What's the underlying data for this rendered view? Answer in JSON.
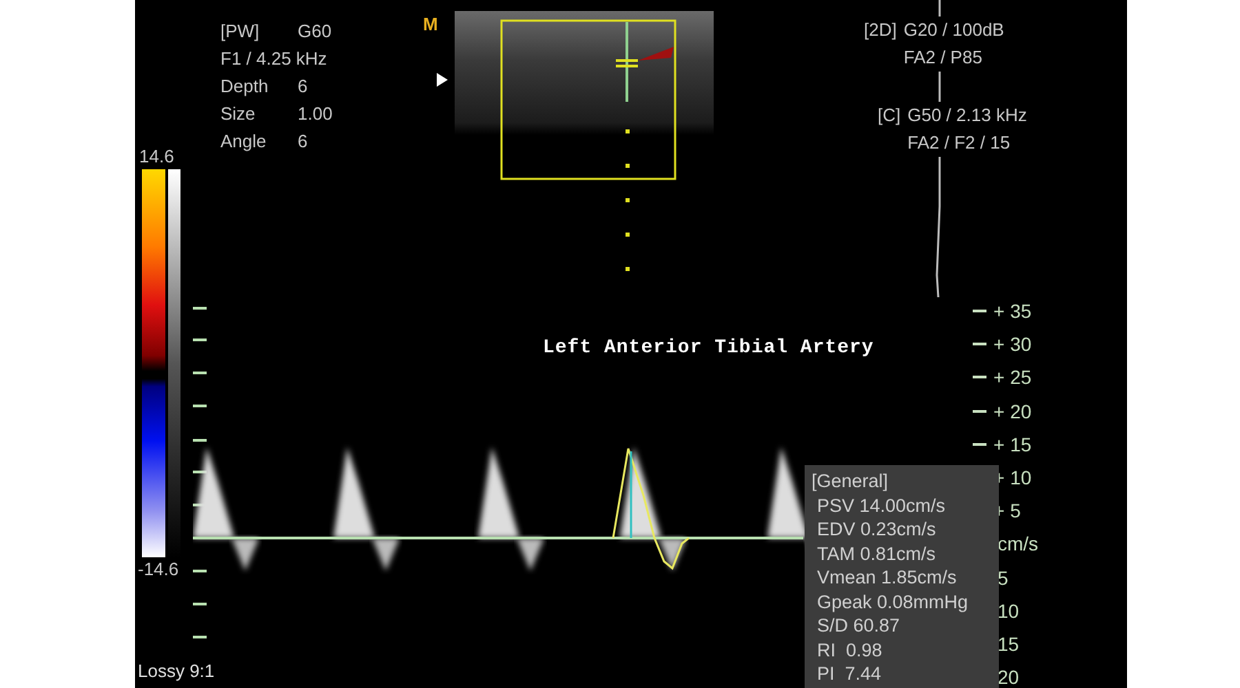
{
  "pw_params": [
    {
      "label": "[PW]",
      "value": "G60"
    },
    {
      "label": "F1 / 4.25 kHz"
    },
    {
      "label": "Depth",
      "value": "6"
    },
    {
      "label": "Size",
      "value": "1.00"
    },
    {
      "label": "Angle",
      "value": "6"
    }
  ],
  "mode_marker": "M",
  "image_params": [
    {
      "header": "[2D]",
      "lines": [
        "G20 / 100dB",
        "FA2 / P85"
      ]
    },
    {
      "header": "[C]",
      "lines": [
        "G50 / 2.13 kHz",
        "FA2 / F2 / 15"
      ]
    }
  ],
  "color_scale": {
    "max": "14.6",
    "min": "-14.6"
  },
  "title": "Left Anterior Tibial Artery",
  "velocity_scale": [
    "+ 35",
    "+ 30",
    "+ 25",
    "+ 20",
    "+ 15",
    "+ 10",
    "+ 5",
    "cm/s",
    "5",
    "10",
    "15",
    "20"
  ],
  "measurements": {
    "title": "[General]",
    "items": [
      "PSV 14.00cm/s",
      "EDV 0.23cm/s",
      "TAM 0.81cm/s",
      "Vmean 1.85cm/s",
      "Gpeak 0.08mmHg",
      "S/D 60.87",
      "RI  0.98",
      "PI  7.44"
    ]
  },
  "compression": "Lossy 9:1"
}
